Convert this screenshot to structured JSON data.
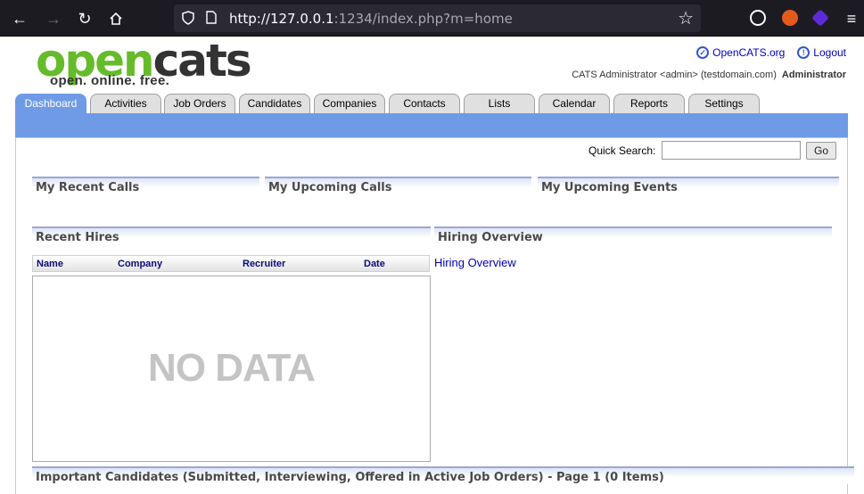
{
  "browser": {
    "url_host": "http://127.0.0.1",
    "url_rest": ":1234/index.php?m=home"
  },
  "logo": {
    "word_open": "open",
    "word_cats": "cats",
    "tagline": "open. online. free."
  },
  "header": {
    "opencats_link": "OpenCATS.org",
    "logout_link": "Logout",
    "user_info": "CATS Administrator <admin> (testdomain.com)",
    "user_role": "Administrator"
  },
  "tabs": [
    {
      "label": "Dashboard"
    },
    {
      "label": "Activities"
    },
    {
      "label": "Job Orders"
    },
    {
      "label": "Candidates"
    },
    {
      "label": "Companies"
    },
    {
      "label": "Contacts"
    },
    {
      "label": "Lists"
    },
    {
      "label": "Calendar"
    },
    {
      "label": "Reports"
    },
    {
      "label": "Settings"
    }
  ],
  "quick_search": {
    "label": "Quick Search:",
    "value": "",
    "button": "Go"
  },
  "sections": {
    "recent_calls": "My Recent Calls",
    "upcoming_calls": "My Upcoming Calls",
    "upcoming_events": "My Upcoming Events",
    "recent_hires": "Recent Hires",
    "hiring_overview": "Hiring Overview",
    "important_candidates": "Important Candidates (Submitted, Interviewing, Offered in Active Job Orders) - Page 1 (0 Items)"
  },
  "hires_table": {
    "columns": [
      "Name",
      "Company",
      "Recruiter",
      "Date"
    ],
    "empty_text": "NO DATA"
  },
  "hiring_overview_link": "Hiring Overview",
  "colors": {
    "tab_active": "#6f9be6",
    "link": "#0000bb",
    "logo_green": "#66bb2a"
  }
}
